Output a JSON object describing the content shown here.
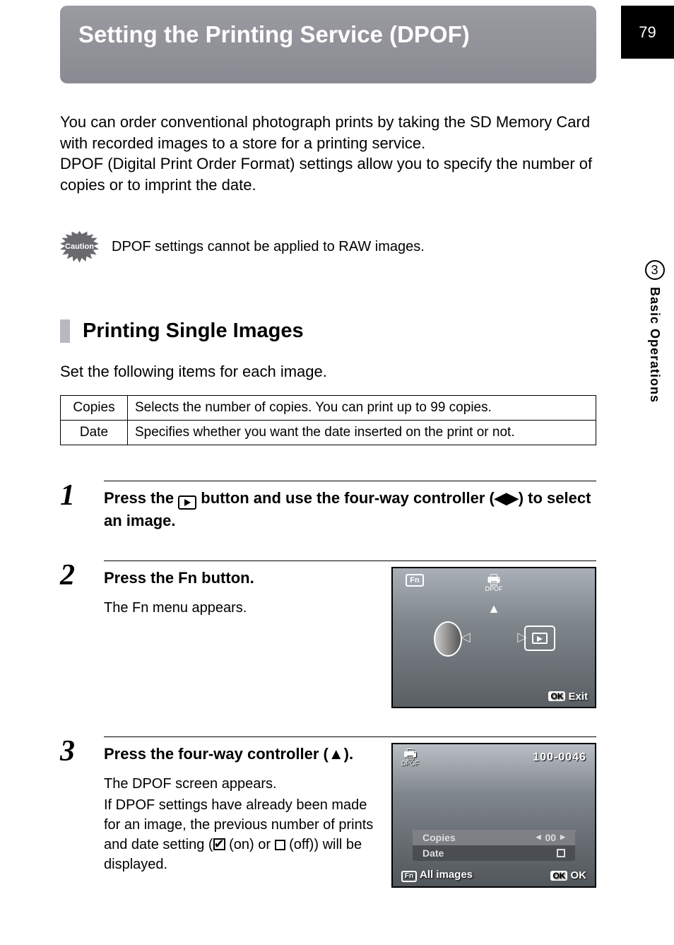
{
  "page_number": "79",
  "side": {
    "chapter_number": "3",
    "chapter_label": "Basic Operations"
  },
  "title": "Setting the Printing Service (DPOF)",
  "intro": "You can order conventional photograph prints by taking the SD Memory Card with recorded images to a store for a printing service.\nDPOF (Digital Print Order Format) settings allow you to specify the number of copies or to imprint the date.",
  "caution": {
    "label": "Caution",
    "text": "DPOF settings cannot be applied to RAW images."
  },
  "section_heading": "Printing Single Images",
  "set_line": "Set the following items for each image.",
  "table": {
    "rows": [
      {
        "label": "Copies",
        "desc": "Selects the number of copies. You can print up to 99 copies."
      },
      {
        "label": "Date",
        "desc": "Specifies whether you want the date inserted on the print or not."
      }
    ]
  },
  "steps": {
    "s1": {
      "num": "1",
      "title_a": "Press the ",
      "title_b": " button and use the four-way controller (",
      "title_c": ") to select an image."
    },
    "s2": {
      "num": "2",
      "title_a": "Press the ",
      "fn": "Fn",
      "title_b": " button.",
      "desc": "The Fn menu appears."
    },
    "s3": {
      "num": "3",
      "title": "Press the four-way controller (▲).",
      "desc_a": "The DPOF screen appears.",
      "desc_b": "If DPOF settings have already been made for an image, the previous number of prints and date setting (",
      "desc_c": " (on) or ",
      "desc_d": " (off)) will be displayed."
    }
  },
  "screen1": {
    "fn": "Fn",
    "dpof": "DPOF",
    "ok": "OK",
    "exit": "Exit"
  },
  "screen2": {
    "dpof": "DPOF",
    "file_no": "100-0046",
    "copies_label": "Copies",
    "copies_value": "00",
    "date_label": "Date",
    "fn": "Fn",
    "all_images": "All images",
    "ok": "OK",
    "ok2": "OK"
  }
}
